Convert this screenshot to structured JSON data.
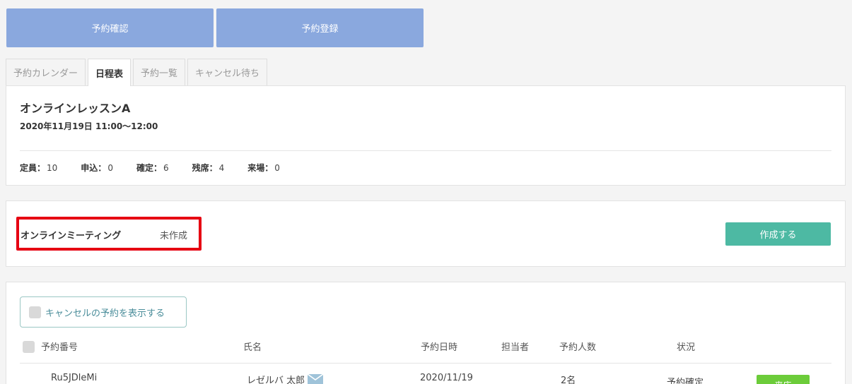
{
  "top_buttons": {
    "confirm": "予約確認",
    "register": "予約登録"
  },
  "tabs": [
    {
      "label": "予約カレンダー"
    },
    {
      "label": "日程表",
      "active": true
    },
    {
      "label": "予約一覧"
    },
    {
      "label": "キャンセル待ち"
    }
  ],
  "lesson": {
    "title": "オンラインレッスンA",
    "date": "2020年11月19日 11:00〜12:00",
    "stats": [
      {
        "label": "定員：",
        "value": "10"
      },
      {
        "label": "申込：",
        "value": "0"
      },
      {
        "label": "確定：",
        "value": "6"
      },
      {
        "label": "残席：",
        "value": "4"
      },
      {
        "label": "来場：",
        "value": "0"
      }
    ]
  },
  "meeting": {
    "label": "オンラインミーティング",
    "status": "未作成",
    "create_button": "作成する",
    "highlight_color": "#e60012"
  },
  "reservations": {
    "show_cancelled_label": "キャンセルの予約を表示する",
    "columns": {
      "number": "予約番号",
      "name": "氏名",
      "datetime": "予約日時",
      "staff": "担当者",
      "count": "予約人数",
      "status": "状況"
    },
    "rows": [
      {
        "number": "Ru5JDleMi",
        "name": "レゼルバ 太郎",
        "datetime": "2020/11/19",
        "staff": "",
        "count": "2名",
        "status": "予約確定",
        "action": "来店"
      }
    ]
  },
  "colors": {
    "top_button": "#8aa8de",
    "create_button": "#4db9a3",
    "action_button": "#6ccc3a"
  }
}
